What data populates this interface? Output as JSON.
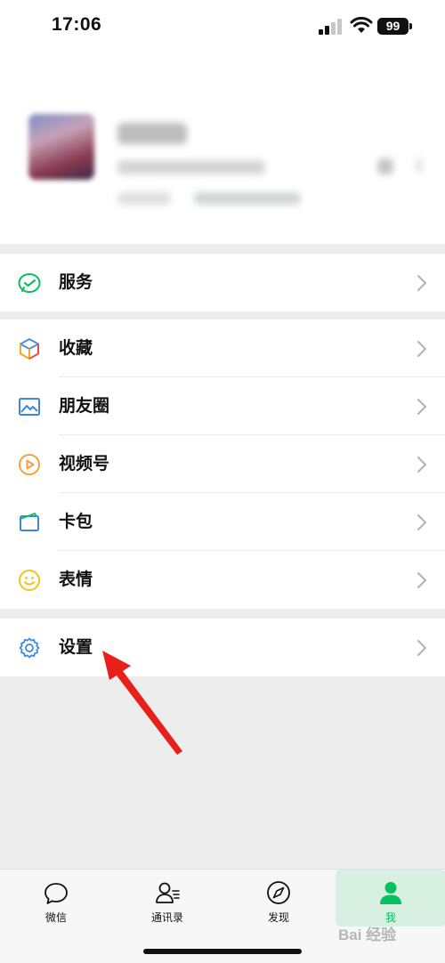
{
  "status_bar": {
    "time": "17:06",
    "battery": "99"
  },
  "menu": {
    "group1": [
      {
        "label": "服务",
        "icon": "wechat-pay-icon"
      }
    ],
    "group2": [
      {
        "label": "收藏",
        "icon": "cube-icon"
      },
      {
        "label": "朋友圈",
        "icon": "image-icon"
      },
      {
        "label": "视频号",
        "icon": "play-circle-icon"
      },
      {
        "label": "卡包",
        "icon": "card-icon"
      },
      {
        "label": "表情",
        "icon": "smiley-icon"
      }
    ],
    "group3": [
      {
        "label": "设置",
        "icon": "gear-icon"
      }
    ]
  },
  "tabs": [
    {
      "label": "微信",
      "icon": "chat-bubble-icon"
    },
    {
      "label": "通讯录",
      "icon": "contacts-icon"
    },
    {
      "label": "发现",
      "icon": "compass-icon"
    },
    {
      "label": "我",
      "icon": "person-icon",
      "active": true
    }
  ],
  "watermark": "Bai 经验",
  "colors": {
    "accent": "#07c160",
    "arrow": "#e8201c",
    "background": "#ededed"
  }
}
